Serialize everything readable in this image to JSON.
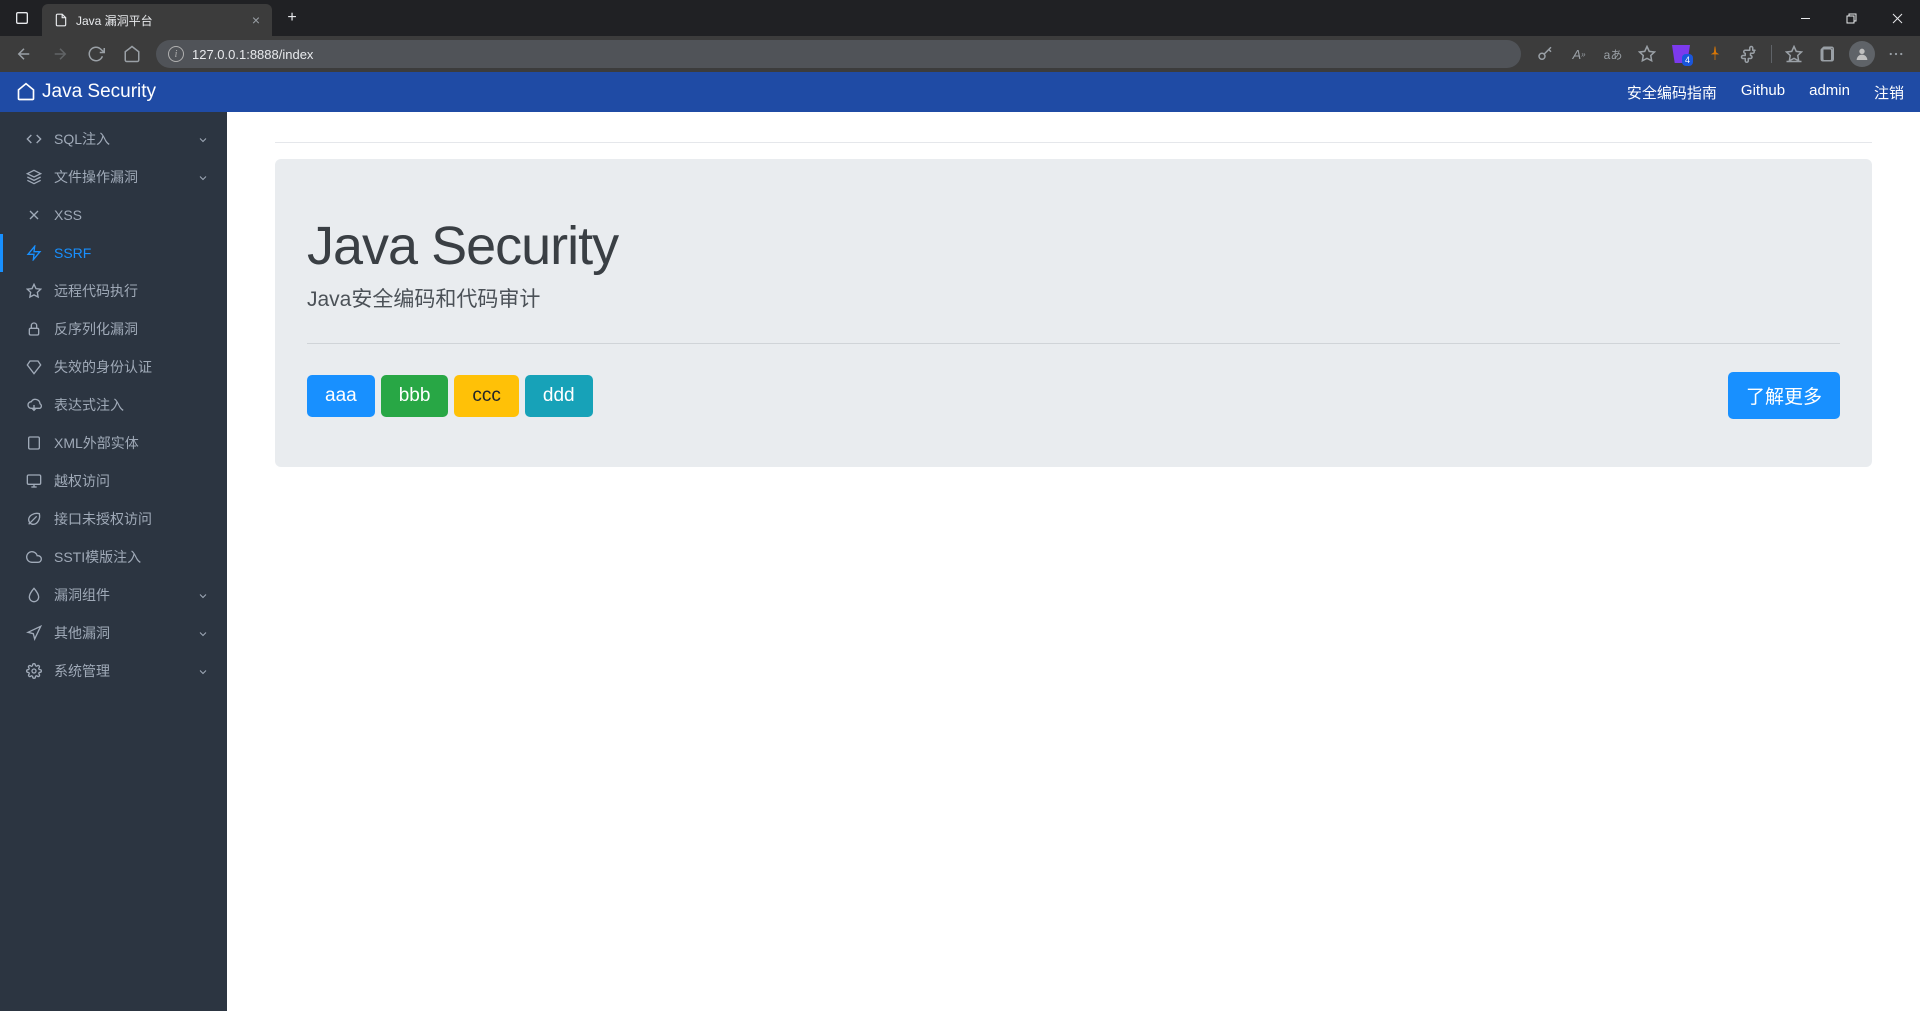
{
  "browser": {
    "tab_title": "Java 漏洞平台",
    "url": "127.0.0.1:8888/index",
    "ext_badge": "4"
  },
  "header": {
    "brand": "Java Security",
    "links": {
      "guide": "安全编码指南",
      "github": "Github",
      "admin": "admin",
      "logout": "注销"
    }
  },
  "sidebar": {
    "items": [
      {
        "label": "SQL注入",
        "icon": "code",
        "expandable": true
      },
      {
        "label": "文件操作漏洞",
        "icon": "layers",
        "expandable": true
      },
      {
        "label": "XSS",
        "icon": "x",
        "expandable": false
      },
      {
        "label": "SSRF",
        "icon": "bolt",
        "expandable": false,
        "active": true
      },
      {
        "label": "远程代码执行",
        "icon": "star",
        "expandable": false
      },
      {
        "label": "反序列化漏洞",
        "icon": "lock",
        "expandable": false
      },
      {
        "label": "失效的身份认证",
        "icon": "diamond",
        "expandable": false
      },
      {
        "label": "表达式注入",
        "icon": "cloud-down",
        "expandable": false
      },
      {
        "label": "XML外部实体",
        "icon": "page",
        "expandable": false
      },
      {
        "label": "越权访问",
        "icon": "monitor",
        "expandable": false
      },
      {
        "label": "接口未授权访问",
        "icon": "leaf",
        "expandable": false
      },
      {
        "label": "SSTI模版注入",
        "icon": "cloud",
        "expandable": false
      },
      {
        "label": "漏洞组件",
        "icon": "drop",
        "expandable": true
      },
      {
        "label": "其他漏洞",
        "icon": "location",
        "expandable": true
      },
      {
        "label": "系统管理",
        "icon": "gear",
        "expandable": true
      }
    ]
  },
  "content": {
    "title": "Java Security",
    "subtitle": "Java安全编码和代码审计",
    "buttons": {
      "a": "aaa",
      "b": "bbb",
      "c": "ccc",
      "d": "ddd",
      "learn": "了解更多"
    }
  }
}
